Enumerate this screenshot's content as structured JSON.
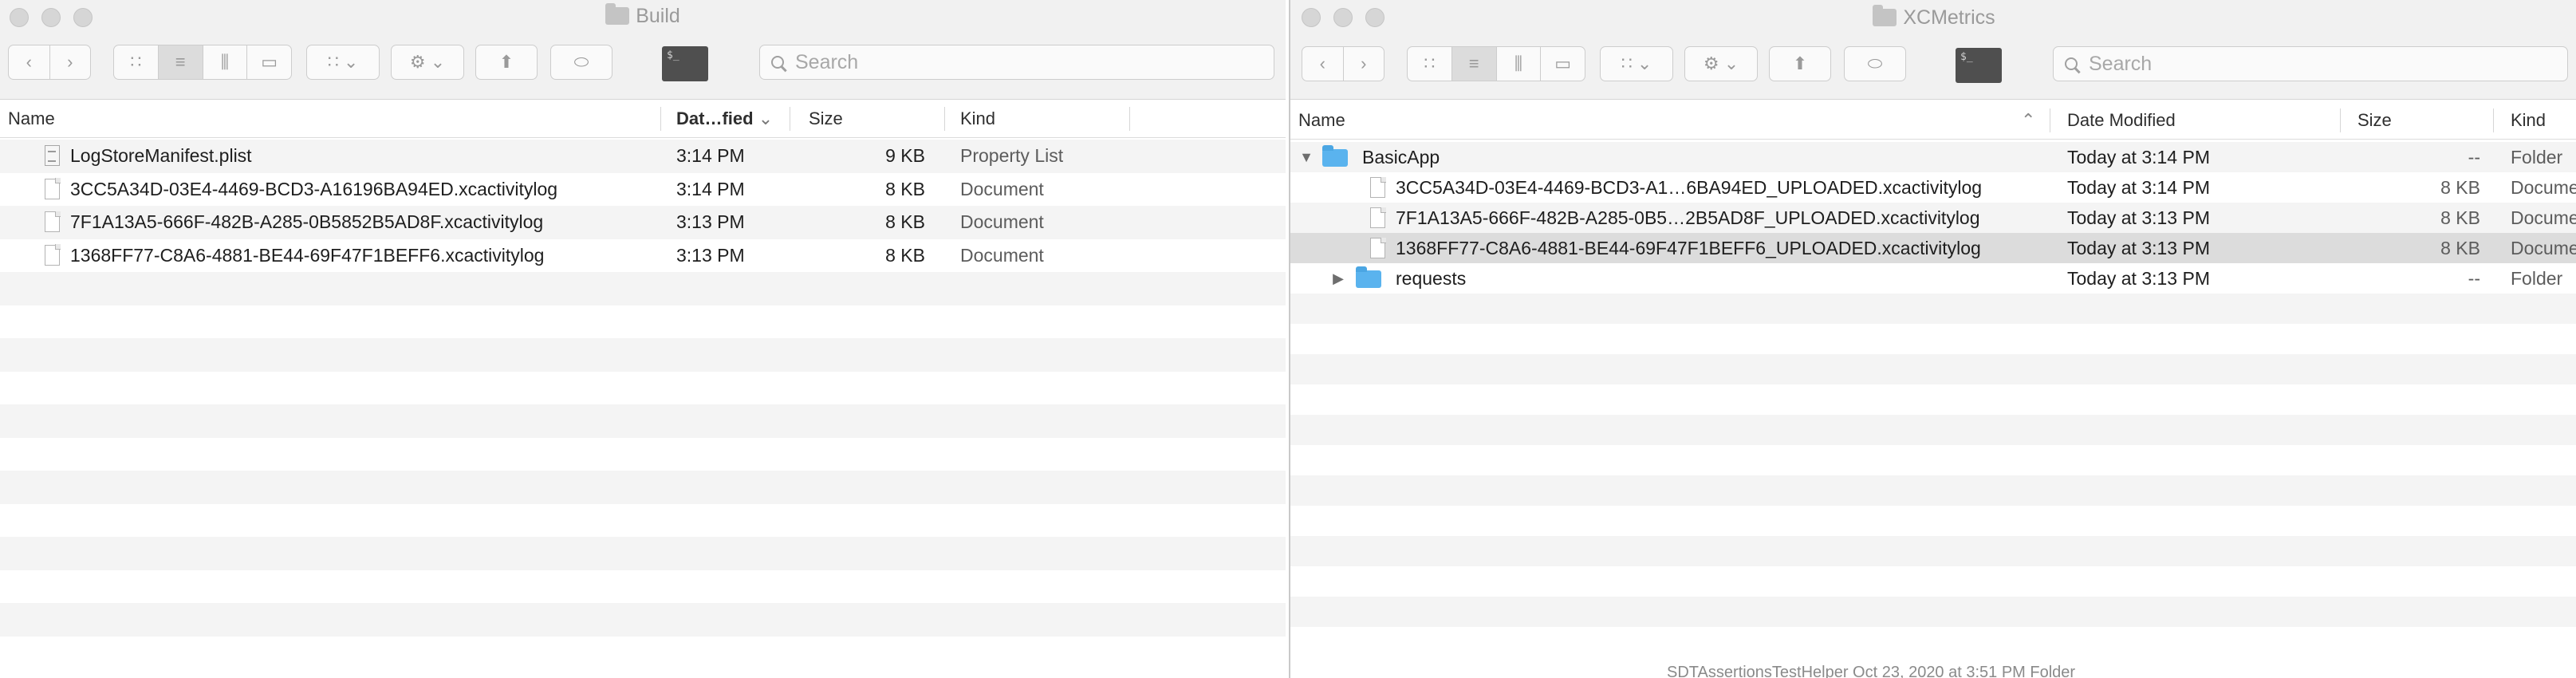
{
  "left_window": {
    "title": "Build",
    "search_placeholder": "Search",
    "terminal_label": "$_",
    "columns": {
      "name": "Name",
      "date": "Dat…fied",
      "size": "Size",
      "kind": "Kind"
    },
    "rows": [
      {
        "name": "LogStoreManifest.plist",
        "date": "3:14 PM",
        "size": "9 KB",
        "kind": "Property List",
        "icon": "plist-file-icon"
      },
      {
        "name": "3CC5A34D-03E4-4469-BCD3-A16196BA94ED.xcactivitylog",
        "date": "3:14 PM",
        "size": "8 KB",
        "kind": "Document",
        "icon": "document-icon"
      },
      {
        "name": "7F1A13A5-666F-482B-A285-0B5852B5AD8F.xcactivitylog",
        "date": "3:13 PM",
        "size": "8 KB",
        "kind": "Document",
        "icon": "document-icon"
      },
      {
        "name": "1368FF77-C8A6-4881-BE44-69F47F1BEFF6.xcactivitylog",
        "date": "3:13 PM",
        "size": "8 KB",
        "kind": "Document",
        "icon": "document-icon"
      }
    ]
  },
  "right_window": {
    "title": "XCMetrics",
    "search_placeholder": "Search",
    "terminal_label": "$_",
    "columns": {
      "name": "Name",
      "date": "Date Modified",
      "size": "Size",
      "kind": "Kind"
    },
    "rows": [
      {
        "name": "BasicApp",
        "date": "Today at 3:14 PM",
        "size": "--",
        "kind": "Folder",
        "icon": "folder-icon",
        "disclosure": "expanded"
      },
      {
        "name": "3CC5A34D-03E4-4469-BCD3-A1…6BA94ED_UPLOADED.xcactivitylog",
        "date": "Today at 3:14 PM",
        "size": "8 KB",
        "kind": "Docume",
        "icon": "document-icon"
      },
      {
        "name": "7F1A13A5-666F-482B-A285-0B5…2B5AD8F_UPLOADED.xcactivitylog",
        "date": "Today at 3:13 PM",
        "size": "8 KB",
        "kind": "Docume",
        "icon": "document-icon"
      },
      {
        "name": "1368FF77-C8A6-4881-BE44-69F47F1BEFF6_UPLOADED.xcactivitylog",
        "date": "Today at 3:13 PM",
        "size": "8 KB",
        "kind": "Docume",
        "icon": "document-icon",
        "selected": true
      },
      {
        "name": "requests",
        "date": "Today at 3:13 PM",
        "size": "--",
        "kind": "Folder",
        "icon": "folder-icon",
        "disclosure": "collapsed"
      }
    ],
    "background_peek_text": "SDTAssertionsTestHelper        Oct 23, 2020 at 3:51 PM        Folder"
  },
  "colors": {
    "titlebar": "#f1f1f1",
    "row_alt": "#f4f4f4",
    "row_selected": "#dcdcdc",
    "folder": "#5ab3ee"
  }
}
